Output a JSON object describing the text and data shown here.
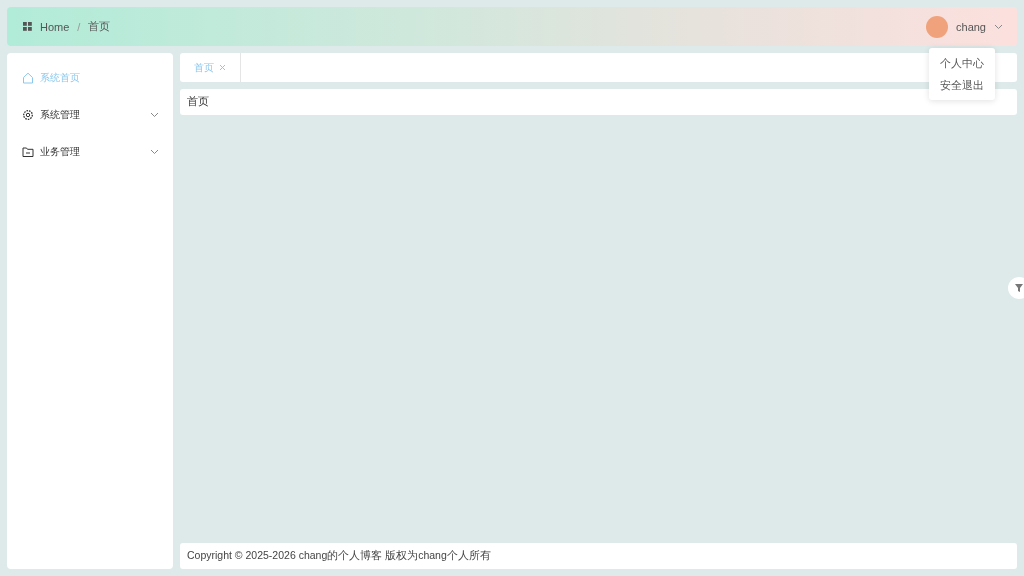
{
  "header": {
    "breadcrumb": [
      "Home",
      "首页"
    ],
    "breadcrumb_separator": "/",
    "user": {
      "name": "chang"
    },
    "user_menu": [
      "个人中心",
      "安全退出"
    ]
  },
  "sidebar": {
    "items": [
      {
        "label": "系统首页",
        "kind": "link",
        "selected": true
      },
      {
        "label": "系统管理",
        "kind": "submenu",
        "selected": false,
        "expanded": false
      },
      {
        "label": "业务管理",
        "kind": "submenu",
        "selected": false,
        "expanded": false
      }
    ]
  },
  "tabs": [
    {
      "label": "首页",
      "selected": true
    }
  ],
  "page_title": "首页",
  "footer": "Copyright © 2025-2026 chang的个人博客 版权为chang个人所有"
}
